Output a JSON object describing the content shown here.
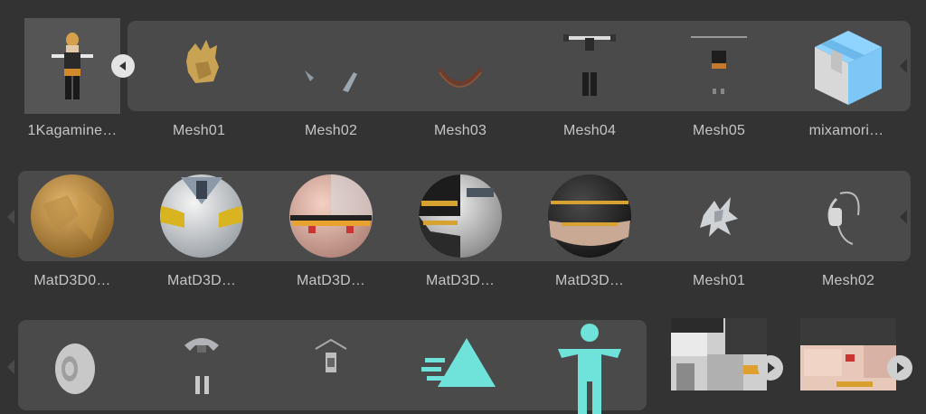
{
  "row1": {
    "items": [
      {
        "label": "1Kagamine…",
        "icon": "character-rig-thumbnail"
      },
      {
        "label": "Mesh01",
        "icon": "hair-mesh-thumbnail"
      },
      {
        "label": "Mesh02",
        "icon": "accessory-mesh-thumbnail"
      },
      {
        "label": "Mesh03",
        "icon": "collar-mesh-thumbnail"
      },
      {
        "label": "Mesh04",
        "icon": "body-mesh-thumbnail"
      },
      {
        "label": "Mesh05",
        "icon": "outfit-mesh-thumbnail"
      },
      {
        "label": "mixamori…",
        "icon": "prefab-box-icon"
      }
    ]
  },
  "row2": {
    "items": [
      {
        "label": "MatD3D0…",
        "icon": "material-sphere-hair"
      },
      {
        "label": "MatD3D…",
        "icon": "material-sphere-yellow-white"
      },
      {
        "label": "MatD3D…",
        "icon": "material-sphere-skin"
      },
      {
        "label": "MatD3D…",
        "icon": "material-sphere-black-white"
      },
      {
        "label": "MatD3D…",
        "icon": "material-sphere-dark"
      },
      {
        "label": "Mesh01",
        "icon": "hair-mesh-thumbnail"
      },
      {
        "label": "Mesh02",
        "icon": "headphone-mesh-thumbnail"
      }
    ]
  },
  "row3": {
    "items": [
      {
        "label": "",
        "icon": "head-mesh-thumbnail"
      },
      {
        "label": "",
        "icon": "outfit-mesh-thumbnail"
      },
      {
        "label": "",
        "icon": "accessory-mesh-thumbnail"
      },
      {
        "label": "",
        "icon": "animation-clip-icon"
      },
      {
        "label": "",
        "icon": "avatar-humanoid-icon"
      },
      {
        "label": "",
        "icon": "texture-thumbnail"
      },
      {
        "label": "",
        "icon": "texture-thumbnail"
      }
    ]
  },
  "colors": {
    "background": "#333333",
    "group": "#4a4a4a",
    "accent": "#6fe3da",
    "prefab": "#7cc7f5"
  }
}
